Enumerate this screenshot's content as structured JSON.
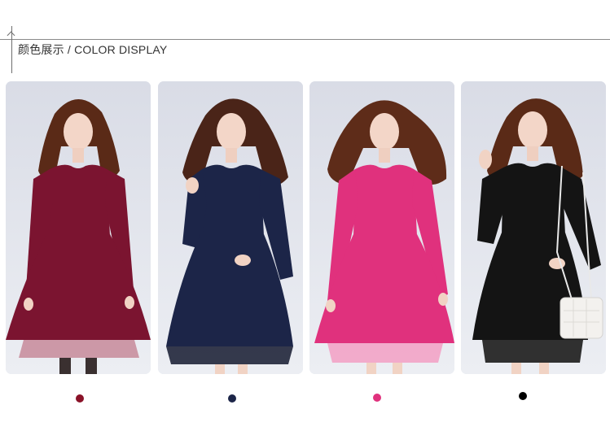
{
  "header": {
    "title_cn": "颜色展示",
    "title_sep": " / ",
    "title_en": "COLOR DISPLAY"
  },
  "products": [
    {
      "color_hex": "#7b1430",
      "lace_hex": "#c78a9a"
    },
    {
      "color_hex": "#1c2548",
      "lace_hex": "#20253a"
    },
    {
      "color_hex": "#e0317d",
      "lace_hex": "#f3a3c7"
    },
    {
      "color_hex": "#141414",
      "lace_hex": "#202020"
    }
  ],
  "swatches": [
    {
      "color_hex": "#8a1228"
    },
    {
      "color_hex": "#1c2548"
    },
    {
      "color_hex": "#e0317d"
    },
    {
      "color_hex": "#000000"
    }
  ]
}
